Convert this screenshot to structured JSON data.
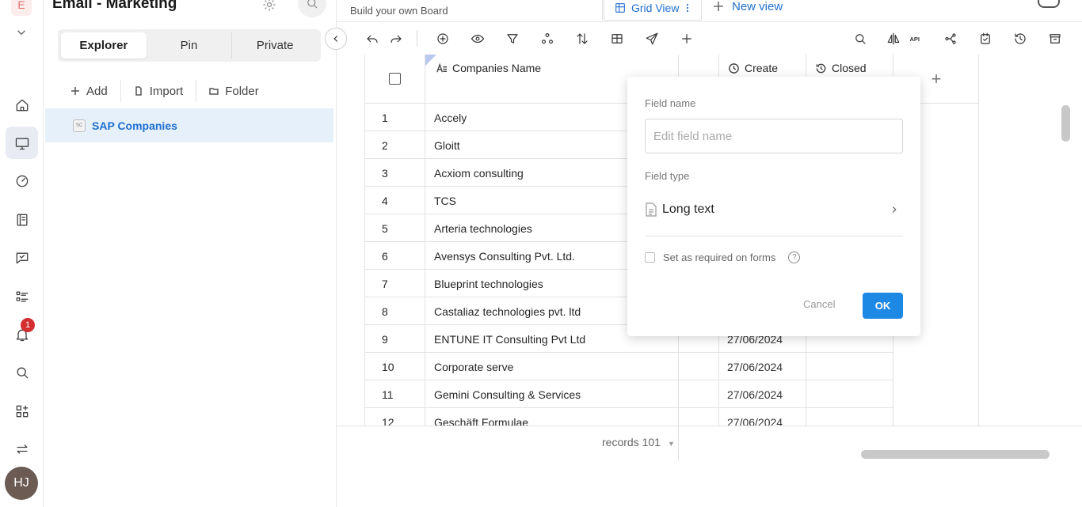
{
  "workspace": {
    "letter": "E",
    "notification_count": "1",
    "user_initials": "HJ"
  },
  "explorer": {
    "project_title": "Email - Marketing",
    "tabs": [
      "Explorer",
      "Pin",
      "Private"
    ],
    "actions": {
      "add": "Add",
      "import": "Import",
      "folder": "Folder"
    },
    "tree_item": {
      "icon_text": "SC",
      "label": "SAP Companies"
    }
  },
  "header": {
    "board_subtitle": "Build your own Board",
    "view_tab": "Grid View",
    "new_view": "New view"
  },
  "grid": {
    "columns": [
      "Companies Name",
      "Create",
      "Closed"
    ],
    "rows": [
      {
        "no": "1",
        "name": "Accely",
        "create": ""
      },
      {
        "no": "2",
        "name": "Gloitt",
        "create": ""
      },
      {
        "no": "3",
        "name": "Acxiom consulting",
        "create": ""
      },
      {
        "no": "4",
        "name": "TCS",
        "create": ""
      },
      {
        "no": "5",
        "name": "Arteria technologies",
        "create": ""
      },
      {
        "no": "6",
        "name": "Avensys Consulting Pvt. Ltd.",
        "create": ""
      },
      {
        "no": "7",
        "name": "Blueprint technologies",
        "create": ""
      },
      {
        "no": "8",
        "name": "Castaliaz technologies pvt. ltd",
        "create": ""
      },
      {
        "no": "9",
        "name": "ENTUNE IT Consulting Pvt Ltd",
        "create": "27/06/2024"
      },
      {
        "no": "10",
        "name": "Corporate serve",
        "create": "27/06/2024"
      },
      {
        "no": "11",
        "name": "Gemini Consulting & Services",
        "create": "27/06/2024"
      },
      {
        "no": "12",
        "name": "Geschäft Formulae",
        "create": "27/06/2024"
      }
    ],
    "add_column_symbol": "+"
  },
  "footer": {
    "records": "records 101"
  },
  "field_popover": {
    "field_name_label": "Field name",
    "field_name_placeholder": "Edit field name",
    "field_type_label": "Field type",
    "field_type_value": "Long text",
    "required_label": "Set as required on forms",
    "help_symbol": "?",
    "cancel": "Cancel",
    "ok": "OK"
  },
  "colors": {
    "accent": "#1e88e5",
    "link": "#1e6fcf",
    "selected_row": "#e6f0fb",
    "badge": "#d32f2f"
  }
}
